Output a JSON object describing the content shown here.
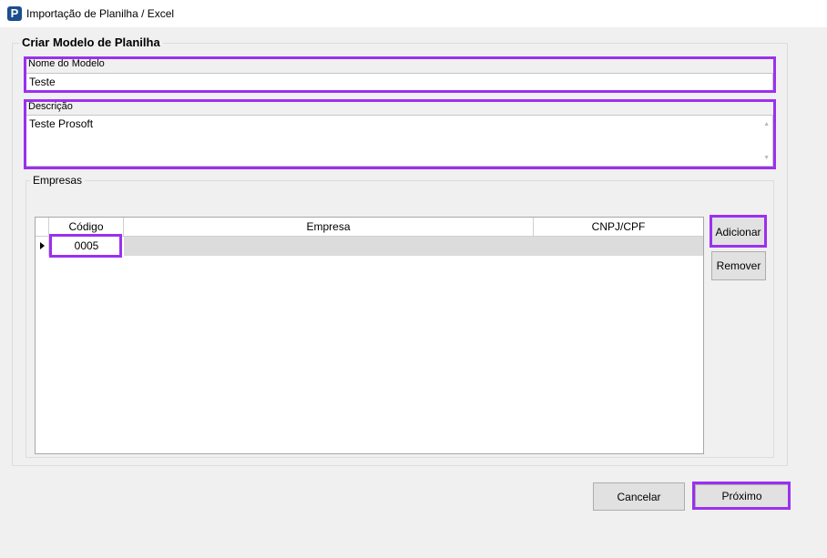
{
  "window": {
    "title": "Importação de Planilha / Excel",
    "icon": "prosoft-app-icon",
    "icon_letter": "P"
  },
  "form": {
    "section_title": "Criar Modelo de Planilha",
    "model_name_label": "Nome do Modelo",
    "model_name_value": "Teste",
    "description_label": "Descrição",
    "description_value": "Teste Prosoft"
  },
  "companies": {
    "group_title": "Empresas",
    "columns": [
      "Código",
      "Empresa",
      "CNPJ/CPF"
    ],
    "rows": [
      {
        "codigo": "0005",
        "empresa": "",
        "cnpj": ""
      }
    ],
    "add_label": "Adicionar",
    "remove_label": "Remover"
  },
  "footer": {
    "cancel_label": "Cancelar",
    "next_label": "Próximo"
  },
  "colors": {
    "highlight": "#9b30f0",
    "focus_border": "#0078d7",
    "window_bg": "#f0f0f0"
  }
}
